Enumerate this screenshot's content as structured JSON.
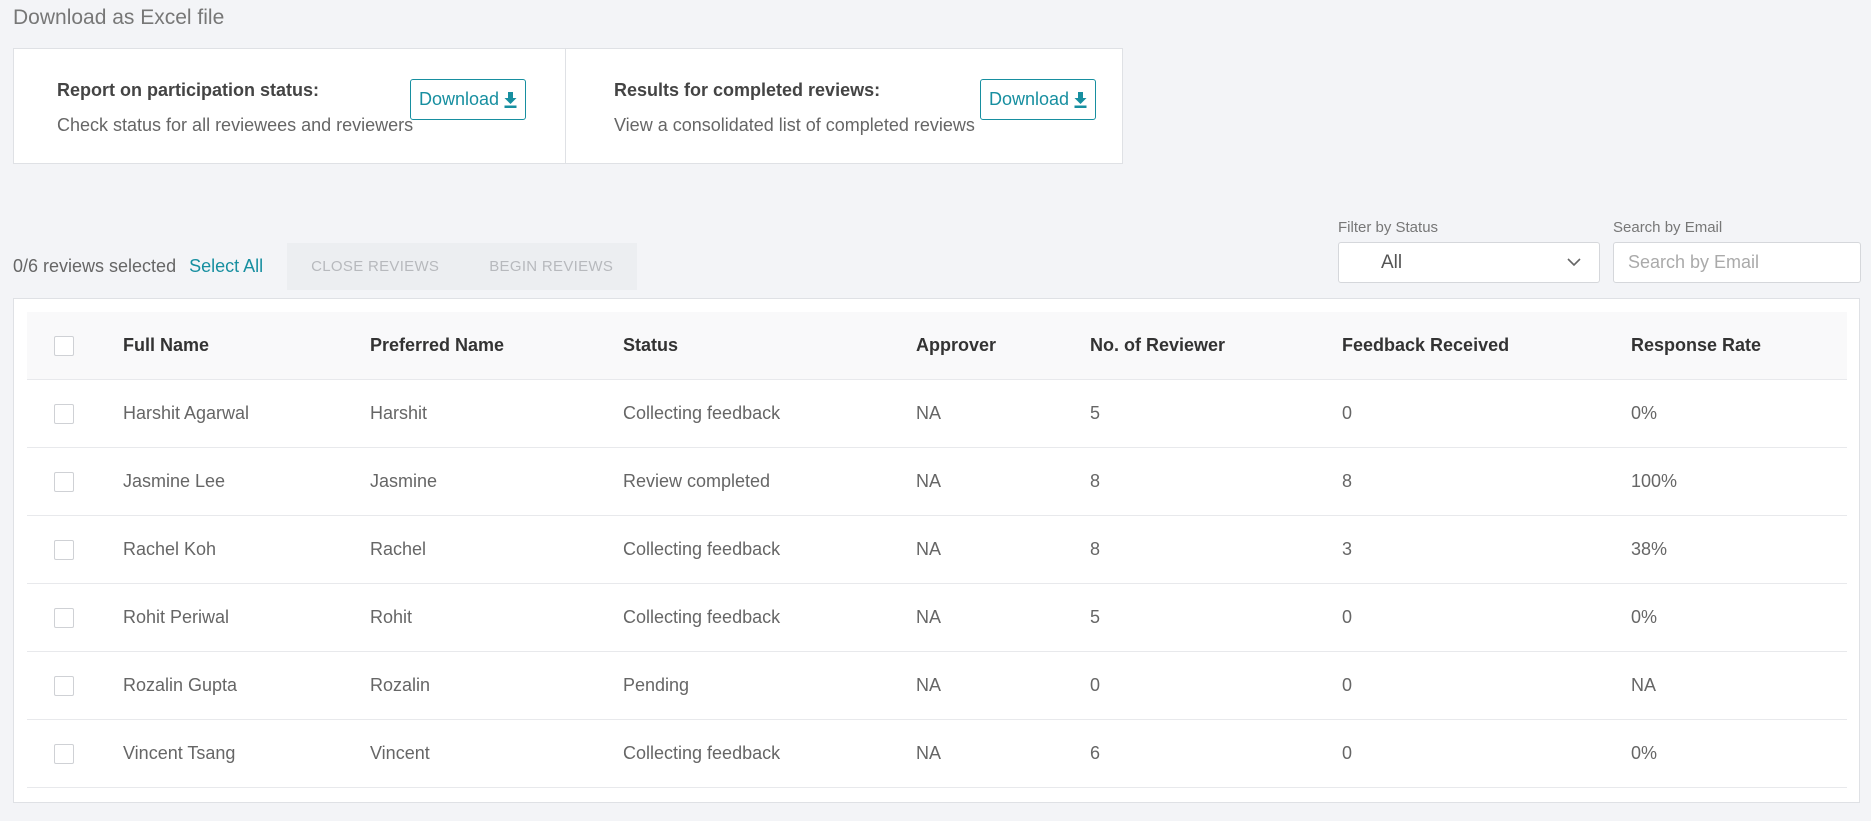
{
  "header": {
    "title": "Download as Excel file"
  },
  "downloads": [
    {
      "title": "Report on participation status:",
      "description": "Check status for all reviewees and reviewers",
      "button_label": "Download"
    },
    {
      "title": "Results for completed reviews:",
      "description": "View a consolidated list of completed reviews",
      "button_label": "Download"
    }
  ],
  "toolbar": {
    "selected_text": "0/6 reviews selected",
    "select_all_label": "Select All",
    "close_reviews_label": "CLOSE REVIEWS",
    "begin_reviews_label": "BEGIN REVIEWS"
  },
  "filter": {
    "label": "Filter by Status",
    "value": "All"
  },
  "search": {
    "label": "Search by Email",
    "placeholder": "Search by Email",
    "value": ""
  },
  "table": {
    "columns": [
      "Full Name",
      "Preferred Name",
      "Status",
      "Approver",
      "No. of Reviewer",
      "Feedback Received",
      "Response Rate"
    ],
    "rows": [
      [
        "Harshit Agarwal",
        "Harshit",
        "Collecting feedback",
        "NA",
        "5",
        "0",
        "0%"
      ],
      [
        "Jasmine Lee",
        "Jasmine",
        "Review completed",
        "NA",
        "8",
        "8",
        "100%"
      ],
      [
        "Rachel Koh",
        "Rachel",
        "Collecting feedback",
        "NA",
        "8",
        "3",
        "38%"
      ],
      [
        "Rohit Periwal",
        "Rohit",
        "Collecting feedback",
        "NA",
        "5",
        "0",
        "0%"
      ],
      [
        "Rozalin Gupta",
        "Rozalin",
        "Pending",
        "NA",
        "0",
        "0",
        "NA"
      ],
      [
        "Vincent Tsang",
        "Vincent",
        "Collecting feedback",
        "NA",
        "6",
        "0",
        "0%"
      ]
    ]
  },
  "colors": {
    "accent": "#178fa0",
    "background": "#f3f4f7"
  }
}
